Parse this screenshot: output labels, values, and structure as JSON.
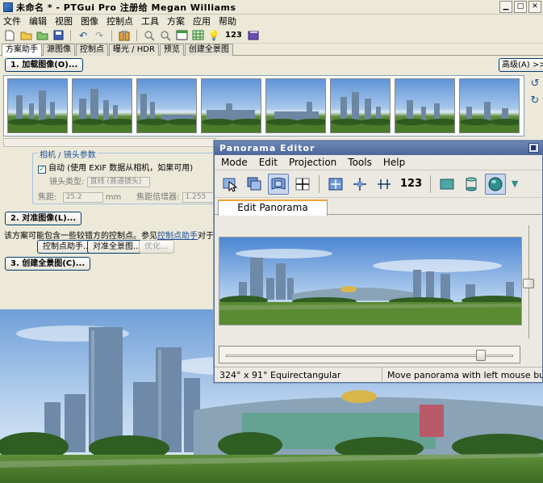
{
  "window": {
    "title": "未命名 * - PTGui Pro 注册给 Megan Williams"
  },
  "menu": [
    "文件",
    "编辑",
    "视图",
    "图像",
    "控制点",
    "工具",
    "方案",
    "应用",
    "帮助"
  ],
  "toolbar": {
    "number_label": "123"
  },
  "tabs": [
    "方案助手",
    "源图像",
    "控制点",
    "曝光 / HDR",
    "预览",
    "创建全景图"
  ],
  "load_button": "1. 加载图像(O)...",
  "advanced_button": "高级(A) >>",
  "thumbnail_count": 8,
  "camera_group": {
    "title": "相机 / 镜头参数",
    "auto_label": "自动 (使用 EXIF 数据从相机，如果可用)",
    "lens_type_label": "镜头类型:",
    "lens_type_value": "直线 (普通镜头)",
    "focal_label": "焦距:",
    "focal_value": "25.2",
    "focal_unit": "mm",
    "multiplier_label": "焦距倍增器:",
    "multiplier_value": "1.255"
  },
  "align_button": "2. 对准图像(L)...",
  "status": {
    "prefix": "该方案可能包含一些较错方的控制点。参见",
    "link": "控制点助手",
    "suffix": "对于详细内容。"
  },
  "cp_assistant_button": "控制点助手...",
  "align_to_pano_button": "对准全景图...",
  "optimize_button": "优化...",
  "create_button": "3. 创建全景图(C)...",
  "editor": {
    "title": "Panorama Editor",
    "menu": [
      "Mode",
      "Edit",
      "Projection",
      "Tools",
      "Help"
    ],
    "number_label": "123",
    "tab": "Edit Panorama",
    "status_left": "324° x 91° Equirectangular",
    "status_right": "Move panorama with left mouse bu"
  },
  "colors": {
    "sky_top": "#5f94d6",
    "grass": "#4f7f30",
    "title_blue": "#4b669a",
    "accent_orange": "#f3a43a"
  }
}
